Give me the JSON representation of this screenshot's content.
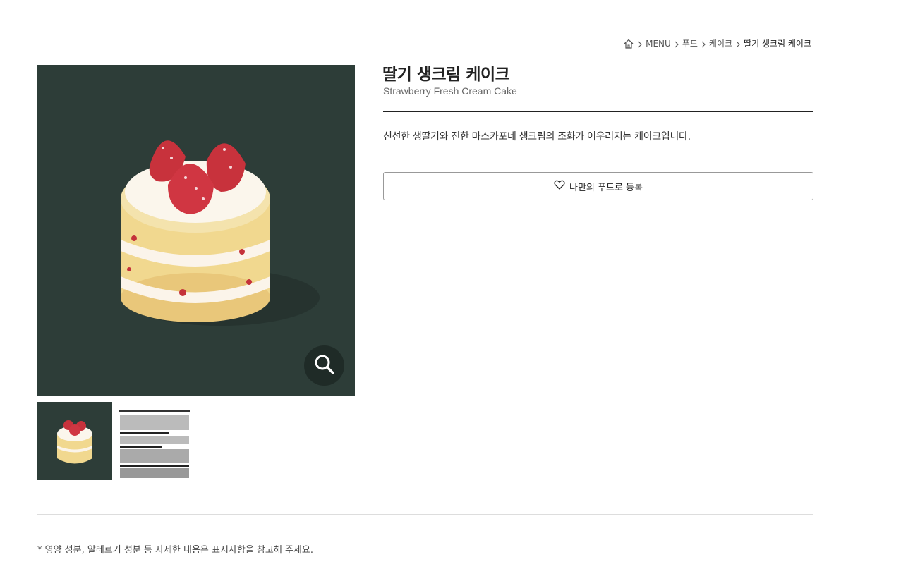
{
  "breadcrumb": {
    "items": [
      "MENU",
      "푸드",
      "케이크"
    ],
    "current": "딸기 생크림 케이크"
  },
  "product": {
    "title": "딸기 생크림 케이크",
    "subtitle": "Strawberry Fresh Cream Cake",
    "description": "신선한 생딸기와 진한 마스카포네 생크림의 조화가 어우러지는 케이크입니다.",
    "favorite_button_label": "나만의 푸드로 등록"
  },
  "footer_note": "* 영양 성분, 알레르기 성분 등 자세한 내용은 표시사항을 참고해 주세요.",
  "colors": {
    "image_bg": "#2d3d38",
    "zoom_bg": "#1f2b27"
  }
}
